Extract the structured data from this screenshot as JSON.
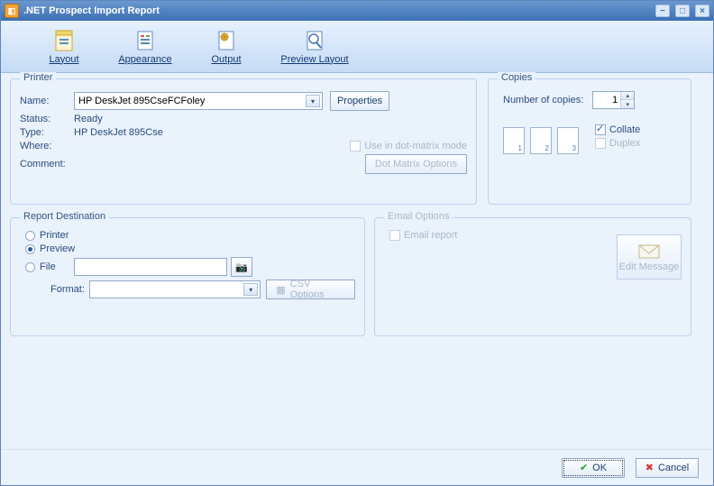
{
  "window": {
    "title": ".NET Prospect Import Report"
  },
  "toolbar": {
    "items": [
      {
        "label": "Layout",
        "icon": "layout"
      },
      {
        "label": "Appearance",
        "icon": "appearance"
      },
      {
        "label": "Output",
        "icon": "output"
      },
      {
        "label": "Preview Layout",
        "icon": "preview"
      }
    ]
  },
  "printer": {
    "legend": "Printer",
    "name_label": "Name:",
    "name_value": "HP DeskJet 895CseFCFoley",
    "properties_btn": "Properties",
    "status_label": "Status:",
    "status_value": "Ready",
    "type_label": "Type:",
    "type_value": "HP DeskJet 895Cse",
    "where_label": "Where:",
    "where_value": "",
    "comment_label": "Comment:",
    "comment_value": "",
    "dotmatrix_label": "Use in dot-matrix mode",
    "dotmatrix_btn": "Dot Matrix Options"
  },
  "copies": {
    "legend": "Copies",
    "num_label": "Number of copies:",
    "num_value": "1",
    "collate_label": "Collate",
    "duplex_label": "Duplex",
    "page_numbers": [
      "1",
      "1",
      "2",
      "2",
      "3",
      "3"
    ]
  },
  "dest": {
    "legend": "Report Destination",
    "printer_label": "Printer",
    "preview_label": "Preview",
    "file_label": "File",
    "format_label": "Format:",
    "csv_btn": "CSV Options"
  },
  "email": {
    "legend": "Email Options",
    "report_label": "Email report",
    "edit_btn": "Edit Message"
  },
  "footer": {
    "ok": "OK",
    "cancel": "Cancel"
  }
}
